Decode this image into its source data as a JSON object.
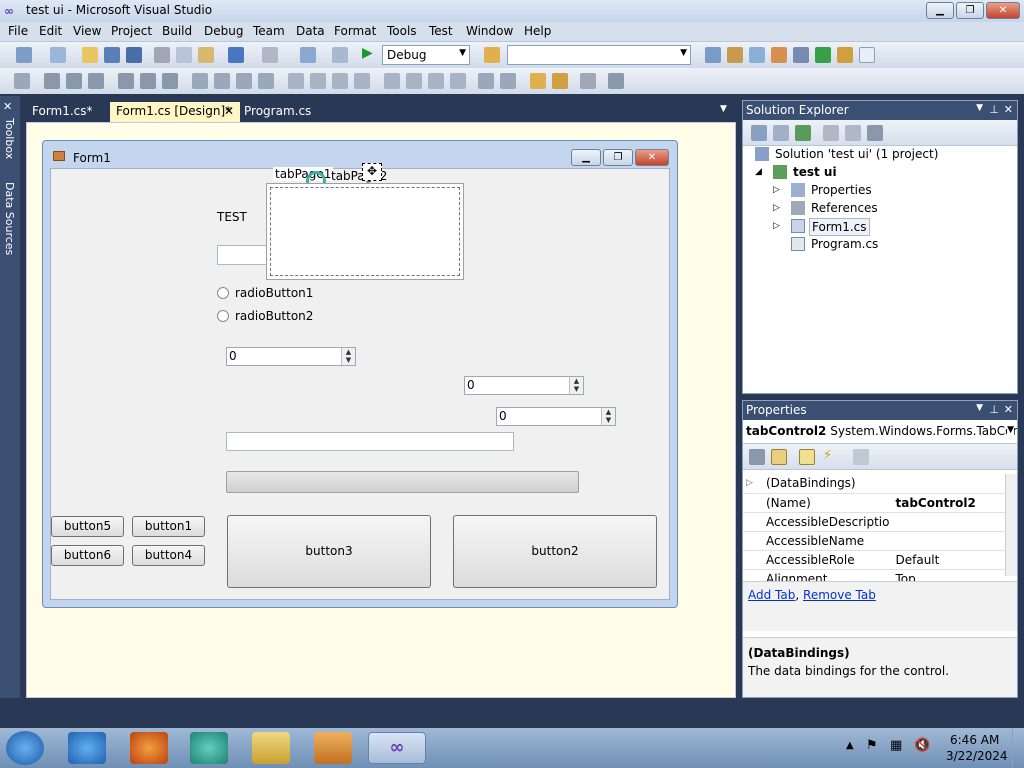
{
  "window": {
    "title": "test ui - Microsoft Visual Studio"
  },
  "menu": [
    "File",
    "Edit",
    "View",
    "Project",
    "Build",
    "Debug",
    "Team",
    "Data",
    "Format",
    "Tools",
    "Test",
    "Window",
    "Help"
  ],
  "toolbar": {
    "config": "Debug",
    "platform": ""
  },
  "sidestrip": {
    "toolbox": "Toolbox",
    "datasources": "Data Sources"
  },
  "tabs": [
    {
      "label": "Form1.cs*"
    },
    {
      "label": "Form1.cs [Design]*"
    },
    {
      "label": "Program.cs"
    }
  ],
  "form": {
    "title": "Form1",
    "label": "TEST",
    "tabpage1": "tabPage1",
    "tabpage2": "tabPage2",
    "radio1": "radioButton1",
    "radio2": "radioButton2",
    "num1": "0",
    "num2": "0",
    "num3": "0",
    "buttons": {
      "b1": "button1",
      "b2": "button2",
      "b3": "button3",
      "b4": "button4",
      "b5": "button5",
      "b6": "button6"
    }
  },
  "solution": {
    "title": "Solution Explorer",
    "root": "Solution 'test ui' (1 project)",
    "project": "test ui",
    "items": [
      "Properties",
      "References",
      "Form1.cs",
      "Program.cs"
    ]
  },
  "properties": {
    "title": "Properties",
    "object": "tabControl2",
    "objecttype": "System.Windows.Forms.TabContro",
    "rows": [
      {
        "name": "(DataBindings)",
        "value": ""
      },
      {
        "name": "(Name)",
        "value": "tabControl2"
      },
      {
        "name": "AccessibleDescriptio",
        "value": ""
      },
      {
        "name": "AccessibleName",
        "value": ""
      },
      {
        "name": "AccessibleRole",
        "value": "Default"
      },
      {
        "name": "Alignment",
        "value": "Top"
      }
    ],
    "link_add": "Add Tab",
    "link_remove": "Remove Tab",
    "desc_title": "(DataBindings)",
    "desc_text": "The data bindings for the control."
  },
  "taskbar": {
    "time": "6:46 AM",
    "date": "3/22/2024"
  },
  "colors": {
    "vsblue": "#293955",
    "panelhead": "#3b4f73",
    "tabactive": "#fff6c4"
  }
}
